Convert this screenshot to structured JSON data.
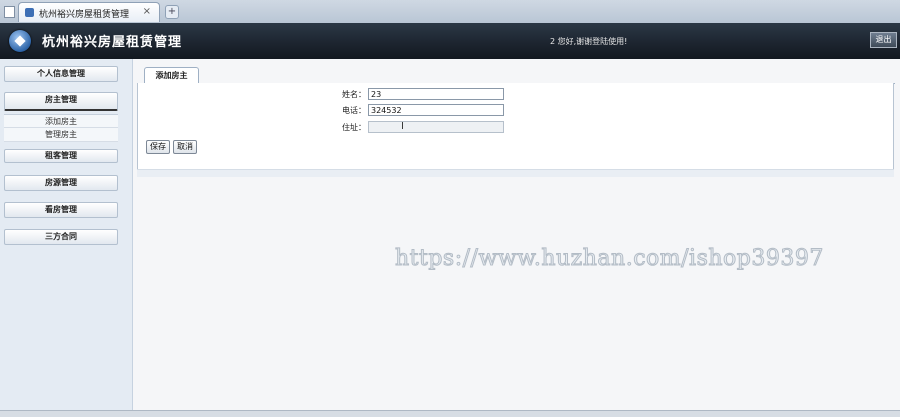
{
  "browser": {
    "tab_title": "杭州裕兴房屋租赁管理",
    "close_glyph": "×",
    "new_tab_glyph": "+"
  },
  "header": {
    "app_title": "杭州裕兴房屋租赁管理",
    "welcome_text": "2 您好,谢谢登陆使用!",
    "logout_label": "退出"
  },
  "sidebar": {
    "items": [
      {
        "label": "个人信息管理"
      },
      {
        "label": "房主管理",
        "expanded": true,
        "children": [
          "添加房主",
          "管理房主"
        ]
      },
      {
        "label": "租客管理"
      },
      {
        "label": "房源管理"
      },
      {
        "label": "看房管理"
      },
      {
        "label": "三方合同"
      }
    ]
  },
  "main": {
    "tab_label": "添加房主",
    "form": {
      "name_label": "姓名：",
      "name_value": "23",
      "phone_label": "电话：",
      "phone_value": "324532",
      "address_label": "住址：",
      "address_value": "",
      "save_label": "保存",
      "cancel_label": "取消"
    }
  },
  "watermark": "https://www.huzhan.com/ishop39397",
  "colors": {
    "header_bg": "#1d2530",
    "sidebar_bg": "#e4ebf3",
    "panel_border": "#9fb0c4"
  }
}
